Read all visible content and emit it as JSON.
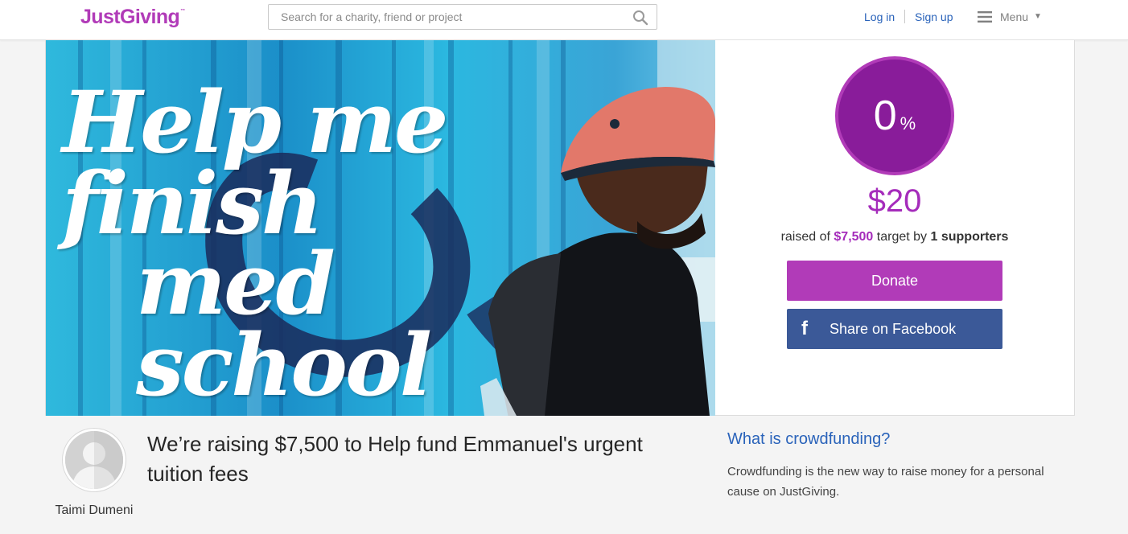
{
  "header": {
    "logo_text": "JustGiving",
    "logo_tm": "™",
    "search_placeholder": "Search for a charity, friend or project",
    "login_label": "Log in",
    "signup_label": "Sign up",
    "menu_label": "Menu",
    "menu_caret": "▼"
  },
  "hero": {
    "headline_line1": "Help me finish",
    "headline_line2": "med school"
  },
  "progress": {
    "percent_value": "0",
    "percent_sign": "%",
    "raised_amount": "$20",
    "raised_prefix": "raised of",
    "target_amount": "$7,500",
    "target_word": "target by",
    "supporters_count": "1",
    "supporters_word": "supporters"
  },
  "actions": {
    "donate_label": "Donate",
    "facebook_icon": "f",
    "facebook_label": "Share on Facebook"
  },
  "owner": {
    "name": "Taimi Dumeni"
  },
  "page": {
    "title": "We’re raising $7,500 to Help fund Emmanuel's urgent tuition fees"
  },
  "crowdfunding": {
    "heading": "What is crowdfunding?",
    "body": "Crowdfunding is the new way to raise money for a personal cause on JustGiving."
  },
  "colors": {
    "brand_purple": "#b13bb8",
    "ring_purple": "#891c9a",
    "link_blue": "#2a63ba",
    "facebook_blue": "#3b5998"
  }
}
